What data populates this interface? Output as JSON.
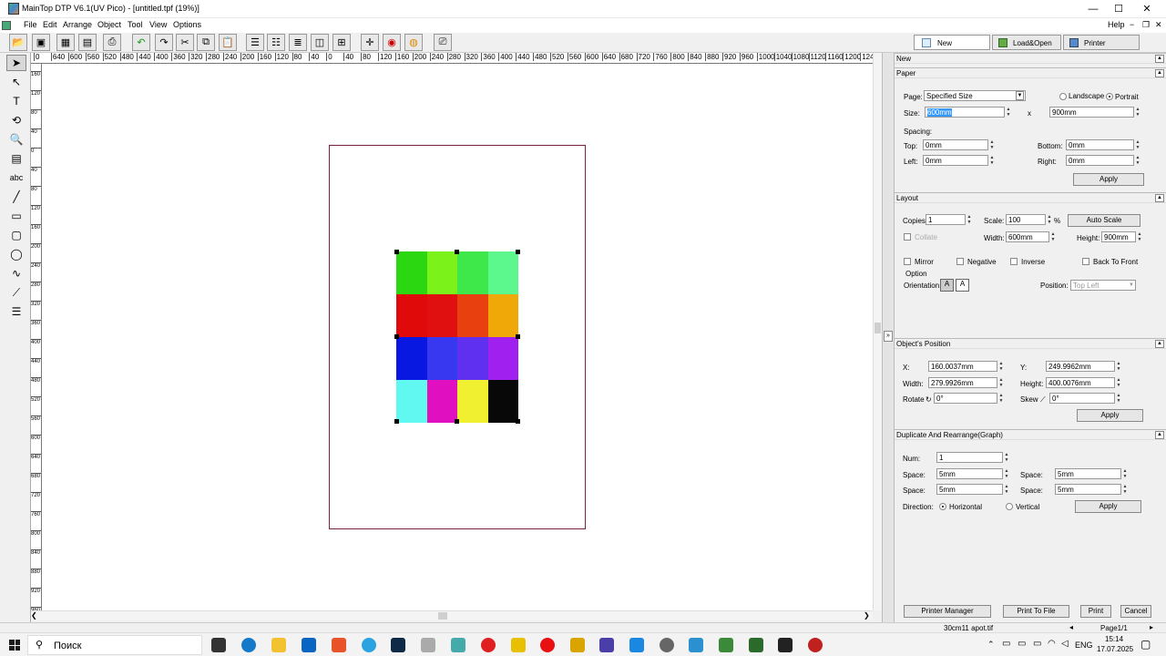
{
  "window": {
    "title": "MainTop DTP V6.1(UV Pico) - [untitled.tpf (19%)]",
    "minimize": "—",
    "maximize": "☐",
    "close": "✕"
  },
  "menu": {
    "items": [
      "File",
      "Edit",
      "Arrange",
      "Object",
      "Tool",
      "View",
      "Options"
    ],
    "help": "Help",
    "right_minus": "−",
    "right_restore": "❐",
    "right_close": "✕"
  },
  "top_tabs": {
    "new": "New",
    "load_open": "Load&Open",
    "printer": "Printer"
  },
  "ruler": {
    "h_labels": [
      "0",
      "640",
      "600",
      "560",
      "520",
      "480",
      "440",
      "400",
      "360",
      "320",
      "280",
      "240",
      "200",
      "160",
      "120",
      "80",
      "40",
      "0",
      "40",
      "80",
      "120",
      "160",
      "200",
      "240",
      "280",
      "320",
      "360",
      "400",
      "440",
      "480",
      "520",
      "560",
      "600",
      "640",
      "680",
      "720",
      "760",
      "800",
      "840",
      "880",
      "920",
      "960",
      "1000",
      "1040",
      "1080",
      "1120",
      "1160",
      "1200",
      "1240",
      "1"
    ],
    "v_labels": [
      "160",
      "120",
      "80",
      "40",
      "0",
      "40",
      "80",
      "120",
      "160",
      "200",
      "240",
      "280",
      "320",
      "360",
      "400",
      "440",
      "480",
      "520",
      "560",
      "600",
      "640",
      "680",
      "720",
      "760",
      "800",
      "840",
      "880",
      "920",
      "960"
    ]
  },
  "panel": {
    "new_header": "New",
    "paper": {
      "header": "Paper",
      "page_label": "Page:",
      "page_value": "Specified Size",
      "landscape": "Landscape",
      "portrait": "Portrait",
      "size_label": "Size:",
      "size_w": "600mm",
      "size_x": "x",
      "size_h": "900mm",
      "spacing": "Spacing:",
      "top_label": "Top:",
      "top_value": "0mm",
      "bottom_label": "Bottom:",
      "bottom_value": "0mm",
      "left_label": "Left:",
      "left_value": "0mm",
      "right_label": "Right:",
      "right_value": "0mm",
      "apply": "Apply"
    },
    "layout": {
      "header": "Layout",
      "copies_label": "Copies:",
      "copies_value": "1",
      "scale_label": "Scale:",
      "scale_value": "100",
      "scale_unit": "%",
      "auto_scale": "Auto Scale",
      "collate": "Collate",
      "width_label": "Width:",
      "width_value": "600mm",
      "height_label": "Height:",
      "height_value": "900mm",
      "mirror": "Mirror",
      "negative": "Negative",
      "inverse": "Inverse",
      "back_to_front": "Back To Front",
      "option": "Option",
      "orientation_label": "Orientation:",
      "position_label": "Position:",
      "position_value": "Top Left"
    },
    "object_position": {
      "header": "Object's Position",
      "x_label": "X:",
      "x_value": "160.0037mm",
      "y_label": "Y:",
      "y_value": "249.9962mm",
      "width_label": "Width:",
      "width_value": "279.9926mm",
      "height_label": "Height:",
      "height_value": "400.0076mm",
      "rotate_label": "Rotate",
      "rotate_value": "0°",
      "skew_label": "Skew",
      "skew_value": "0°",
      "apply": "Apply"
    },
    "duplicate": {
      "header": "Duplicate And Rearrange(Graph)",
      "num_label": "Num:",
      "num_value": "1",
      "space_label": "Space:",
      "space1": "5mm",
      "space2": "5mm",
      "space3": "5mm",
      "space4": "5mm",
      "direction_label": "Direction:",
      "horizontal": "Horizontal",
      "vertical": "Vertical",
      "apply": "Apply"
    },
    "bottom_buttons": {
      "printer_manager": "Printer Manager",
      "print_to_file": "Print To File",
      "print": "Print",
      "cancel": "Cancel"
    }
  },
  "status": {
    "file": "30cm11 apot.tif",
    "page": "Page1/1"
  },
  "swatches": [
    "#2ad710",
    "#7bf21a",
    "#3ee84a",
    "#5cf88e",
    "#e00a0a",
    "#e01010",
    "#e8400e",
    "#f0a808",
    "#0818e0",
    "#3838f0",
    "#6030f0",
    "#a020f0",
    "#60f8f0",
    "#e010c0",
    "#f0f030",
    "#080808"
  ],
  "taskbar": {
    "search": "Поиск",
    "lang": "ENG",
    "time": "15:14",
    "date": "17.07.2025"
  }
}
